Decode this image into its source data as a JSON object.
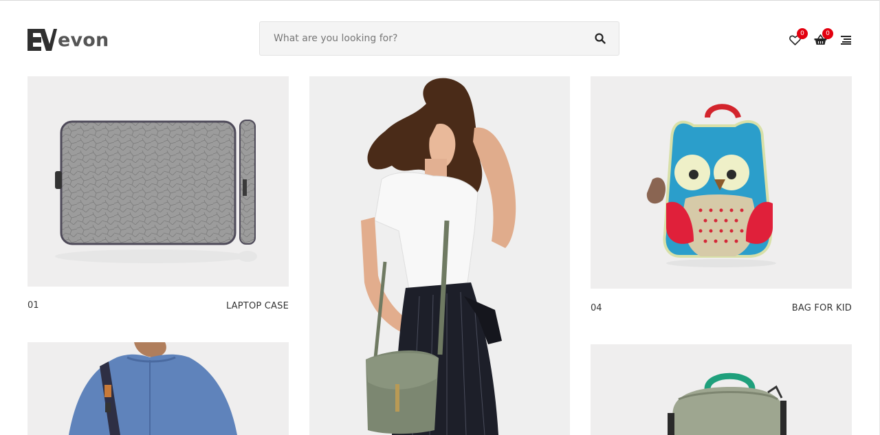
{
  "brand": {
    "name": "evon",
    "mark": "EV"
  },
  "search": {
    "placeholder": "What are you looking for?",
    "value": ""
  },
  "header": {
    "wishlist_count": "0",
    "cart_count": "0",
    "icons": [
      "heart-icon",
      "basket-icon",
      "menu-icon"
    ]
  },
  "products": [
    {
      "number": "01",
      "title": "LAPTOP CASE",
      "image": "laptop-sleeve"
    },
    {
      "number": "",
      "title": "",
      "image": "woman-with-shoulder-bag"
    },
    {
      "number": "04",
      "title": "BAG FOR KID",
      "image": "owl-kids-backpack"
    },
    {
      "number": "",
      "title": "",
      "image": "man-with-messenger-bag"
    },
    {
      "number": "",
      "title": "",
      "image": "green-backpack"
    }
  ],
  "colors": {
    "badge": "#e3000f",
    "tile_bg": "#efeeee",
    "text": "#333333"
  }
}
